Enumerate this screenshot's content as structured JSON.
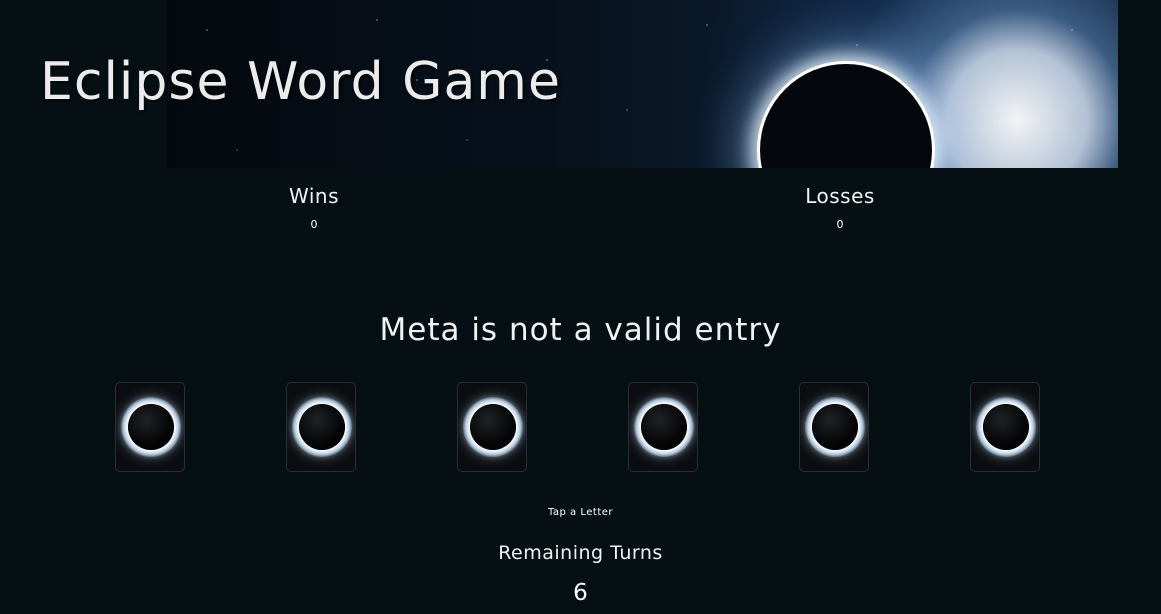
{
  "header": {
    "title": "Eclipse Word Game"
  },
  "score": {
    "wins_label": "Wins",
    "wins_value": "0",
    "losses_label": "Losses",
    "losses_value": "0"
  },
  "message": "Meta is not a valid entry",
  "tiles": [
    {
      "icon": "eclipse-icon",
      "letter": ""
    },
    {
      "icon": "eclipse-icon",
      "letter": ""
    },
    {
      "icon": "eclipse-icon",
      "letter": ""
    },
    {
      "icon": "eclipse-icon",
      "letter": ""
    },
    {
      "icon": "eclipse-icon",
      "letter": ""
    },
    {
      "icon": "eclipse-icon",
      "letter": ""
    }
  ],
  "hint": "Tap a Letter",
  "turns": {
    "label": "Remaining Turns",
    "value": "6"
  },
  "colors": {
    "background": "#061014",
    "text": "#f2f2f2"
  }
}
